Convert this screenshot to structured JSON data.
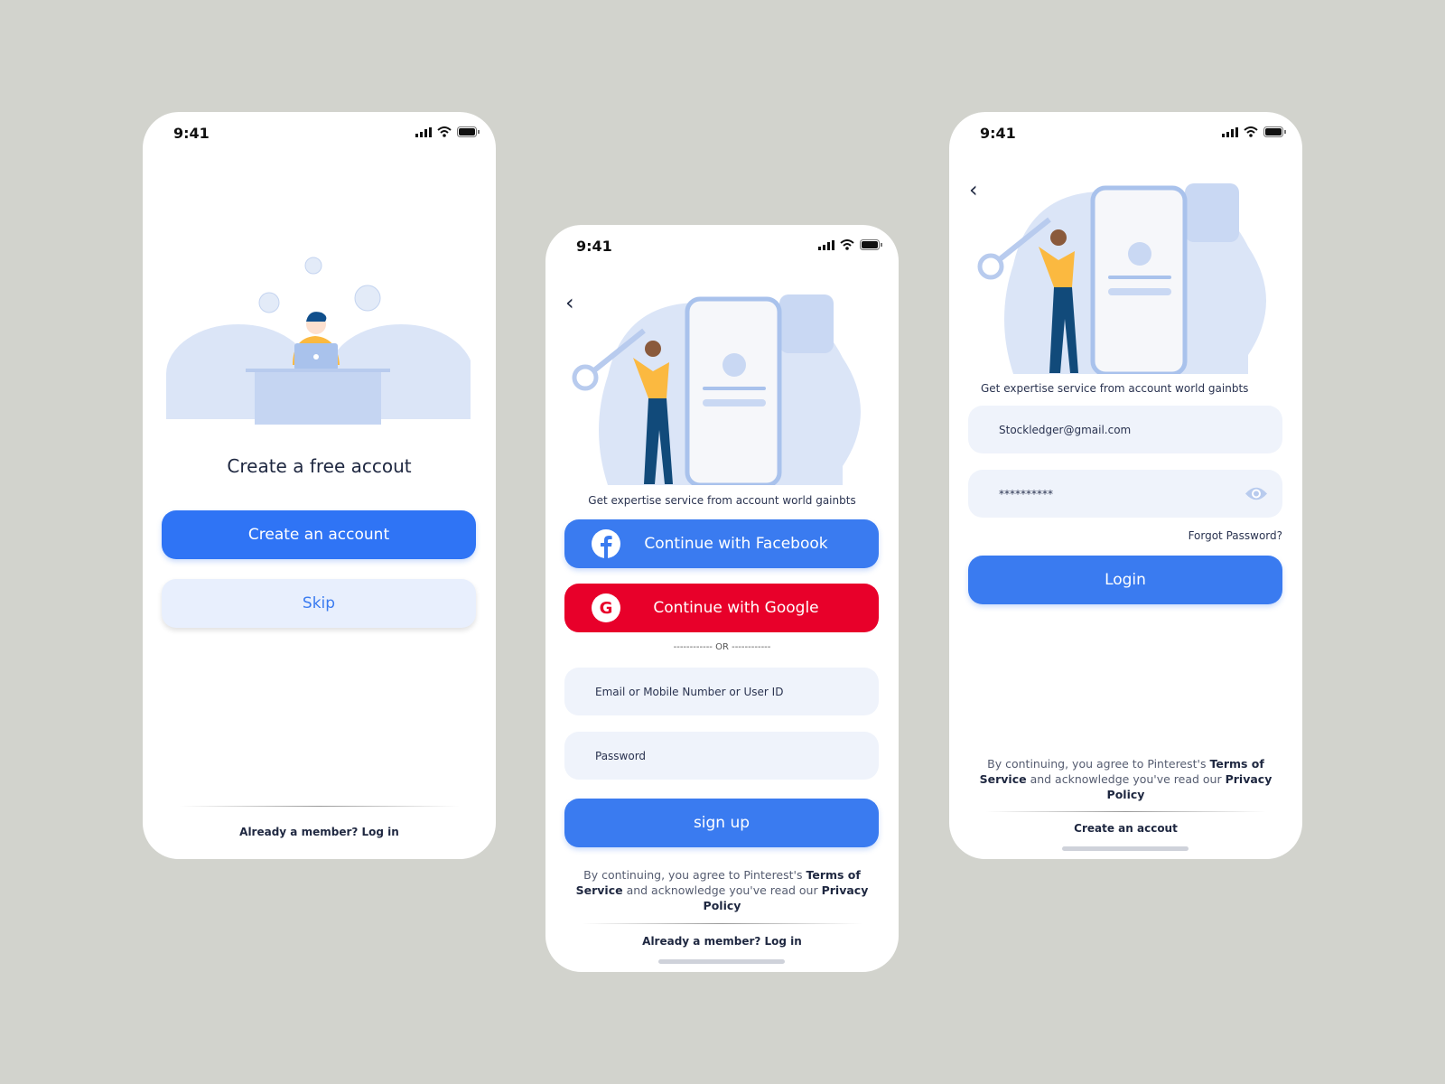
{
  "status": {
    "time": "9:41"
  },
  "screen1": {
    "title": "Create a free accout",
    "create_button": "Create an account",
    "skip_button": "Skip",
    "footer": "Already a member? Log in"
  },
  "screen2": {
    "caption": "Get expertise service from account world gainbts",
    "facebook_button": "Continue with Facebook",
    "google_button": "Continue with Google",
    "or_divider": "------------ OR ------------",
    "email_placeholder": "Email or Mobile Number or User ID",
    "password_placeholder": "Password",
    "signup_button": "sign up",
    "terms": {
      "pre": "By continuing, you agree to Pinterest's ",
      "tos": "Terms of Service",
      "mid": " and acknowledge you've read our ",
      "privacy": "Privacy Policy"
    },
    "footer": "Already a member? Log in"
  },
  "screen3": {
    "caption": "Get expertise service from account world gainbts",
    "email_value": "Stockledger@gmail.com",
    "password_value": "**********",
    "forgot": "Forgot Password?",
    "login_button": "Login",
    "terms": {
      "pre": "By continuing, you agree to Pinterest's ",
      "tos": "Terms of Service",
      "mid": " and acknowledge you've read our ",
      "privacy": "Privacy Policy"
    },
    "footer": "Create an accout"
  },
  "colors": {
    "primary": "#3a7bf0",
    "google": "#e8002a",
    "input_bg": "#eff3fb",
    "illustration": "#dbe5f7"
  }
}
